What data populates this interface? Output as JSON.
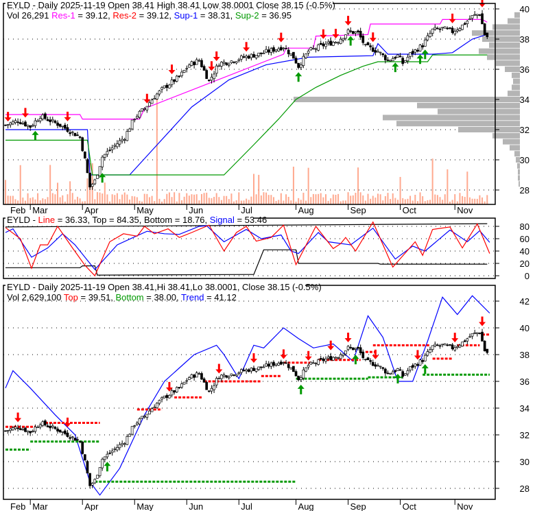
{
  "symbol": "EYLD",
  "colors": {
    "res1": "#ff00ff",
    "res2": "#ff0000",
    "sup1": "#0000ff",
    "sup2": "#009900",
    "volume": "#ffa98f",
    "profile": "#b4b4b4",
    "up_arrow": "#009900",
    "down_arrow": "#ff0000",
    "line": "#ff0000",
    "signal": "#0000ff",
    "top": "#ff0000",
    "bottom": "#009900",
    "trend": "#0000ff"
  },
  "panel1": {
    "header1": "EYLD - Daily 2025-11-19 Open 38.41  High 38.41  Low 38.0001  Close 38.15 (-0.5%)",
    "vol": "Vol 26,291",
    "res1": "Res-1",
    "res1_val": " = 39.12, ",
    "res2": "Res-2",
    "res2_val": " = 39.12, ",
    "sup1": "Sup-1",
    "sup1_val": " = 38.31, ",
    "sup2": "Sup-2",
    "sup2_val": " = 36.95",
    "y_ticks": [
      "40",
      "38",
      "36",
      "34",
      "32",
      "30",
      "28"
    ]
  },
  "panel2": {
    "prefix": "EYLD - ",
    "line": "Line",
    "line_val": " = 36.33, Top = 84.35, Bottom = 18.76, ",
    "signal": "Signal",
    "signal_val": " = 53.46",
    "y_ticks": [
      "80",
      "60",
      "40",
      "20",
      "0"
    ]
  },
  "panel3": {
    "header1": "EYLD - Daily 2025-11-19 Open 38.41,Hi 38.41,Lo 38.0001, Close 38.15 (-0.5%)",
    "vol": "Vol 2,629,100 ",
    "top": "Top",
    "top_val": " = 39.51, ",
    "bottom": "Bottom",
    "bottom_val": " = 38.00, ",
    "trend": "Trend",
    "trend_val": " = 41.12",
    "y_ticks": [
      "42",
      "40",
      "38",
      "36",
      "34",
      "32",
      "30",
      "28"
    ]
  },
  "months": [
    "Feb",
    "Mar",
    "Apr",
    "May",
    "Jun",
    "Jul",
    "Aug",
    "Sep",
    "Oct",
    "Nov"
  ],
  "chart_data": [
    {
      "type": "line",
      "title": "EYLD - Daily price with support/resistance",
      "x_unit": "trading day index (Feb 20 = 0, Nov 19 = 194)",
      "month_ticks": {
        "Mar": 10,
        "Apr": 31,
        "May": 52,
        "Jun": 73,
        "Jul": 94,
        "Aug": 117,
        "Sep": 138,
        "Oct": 159,
        "Nov": 181
      },
      "ylim": [
        27.5,
        40.3
      ],
      "close": [
        [
          0,
          32.3
        ],
        [
          5,
          32.6
        ],
        [
          10,
          32.2
        ],
        [
          14,
          32.9
        ],
        [
          18,
          32.6
        ],
        [
          22,
          32.3
        ],
        [
          26,
          31.9
        ],
        [
          30,
          31.5
        ],
        [
          32,
          30
        ],
        [
          34,
          28.2
        ],
        [
          36,
          28.6
        ],
        [
          39,
          30.2
        ],
        [
          43,
          30.8
        ],
        [
          48,
          31.5
        ],
        [
          52,
          32.8
        ],
        [
          56,
          33.4
        ],
        [
          60,
          34.2
        ],
        [
          64,
          34.8
        ],
        [
          70,
          35.5
        ],
        [
          74,
          36.3
        ],
        [
          78,
          36.6
        ],
        [
          82,
          35.2
        ],
        [
          86,
          36.4
        ],
        [
          90,
          36.5
        ],
        [
          96,
          36.8
        ],
        [
          102,
          37.0
        ],
        [
          108,
          37.3
        ],
        [
          112,
          37.5
        ],
        [
          116,
          36.8
        ],
        [
          118,
          36.2
        ],
        [
          122,
          37.2
        ],
        [
          128,
          37.6
        ],
        [
          134,
          37.9
        ],
        [
          138,
          38.5
        ],
        [
          142,
          38.4
        ],
        [
          145,
          37.5
        ],
        [
          150,
          37.2
        ],
        [
          154,
          36.6
        ],
        [
          158,
          36.9
        ],
        [
          160,
          36.4
        ],
        [
          163,
          37.0
        ],
        [
          168,
          37.6
        ],
        [
          172,
          38.6
        ],
        [
          176,
          38.7
        ],
        [
          180,
          38.5
        ],
        [
          184,
          38.9
        ],
        [
          188,
          39.5
        ],
        [
          191,
          39.7
        ],
        [
          193,
          38.3
        ],
        [
          194,
          38.15
        ]
      ],
      "res1": [
        [
          0,
          33.0
        ],
        [
          30,
          33.0
        ],
        [
          31,
          32.7
        ],
        [
          54,
          32.7
        ],
        [
          56,
          33.4
        ],
        [
          112,
          37.0
        ],
        [
          113,
          37.4
        ],
        [
          124,
          37.4
        ],
        [
          125,
          38.2
        ],
        [
          146,
          38.3
        ],
        [
          147,
          39.0
        ],
        [
          175,
          39.0
        ],
        [
          176,
          39.3
        ],
        [
          192,
          39.3
        ],
        [
          194,
          39.12
        ]
      ],
      "sup1": [
        [
          0,
          32.0
        ],
        [
          33,
          32.0
        ],
        [
          34,
          29.0
        ],
        [
          50,
          29.0
        ],
        [
          60,
          30.8
        ],
        [
          75,
          33.5
        ],
        [
          90,
          35.3
        ],
        [
          105,
          36.3
        ],
        [
          122,
          36.8
        ],
        [
          148,
          36.9
        ],
        [
          150,
          37.7
        ],
        [
          154,
          37.0
        ],
        [
          172,
          37.0
        ],
        [
          180,
          37.1
        ],
        [
          188,
          38.0
        ],
        [
          194,
          38.31
        ]
      ],
      "sup2": [
        [
          0,
          31.3
        ],
        [
          33,
          31.3
        ],
        [
          35,
          29.0
        ],
        [
          88,
          29.0
        ],
        [
          100,
          31.0
        ],
        [
          110,
          32.7
        ],
        [
          117,
          34.0
        ],
        [
          125,
          34.8
        ],
        [
          135,
          35.6
        ],
        [
          144,
          36.2
        ],
        [
          150,
          36.5
        ],
        [
          170,
          36.5
        ],
        [
          172,
          36.95
        ],
        [
          194,
          36.95
        ]
      ],
      "down_arrows": [
        1,
        8,
        25,
        57,
        67,
        83,
        85,
        97,
        111,
        128,
        133,
        138,
        148,
        180,
        192
      ],
      "up_arrows": [
        12,
        39,
        118,
        139,
        157,
        167,
        169
      ],
      "volume_profile": [
        [
          40,
          0
        ],
        [
          39.6,
          8
        ],
        [
          39.2,
          18
        ],
        [
          38.8,
          40
        ],
        [
          38.4,
          70
        ],
        [
          38.0,
          55
        ],
        [
          37.6,
          45
        ],
        [
          37.2,
          60
        ],
        [
          36.8,
          48
        ],
        [
          36.4,
          35
        ],
        [
          36.0,
          22
        ],
        [
          35.6,
          12
        ],
        [
          35.2,
          10
        ],
        [
          34.8,
          12
        ],
        [
          34.4,
          18
        ],
        [
          34.0,
          330
        ],
        [
          33.6,
          150
        ],
        [
          33.2,
          120
        ],
        [
          32.8,
          200
        ],
        [
          32.4,
          180
        ],
        [
          32.0,
          90
        ],
        [
          31.6,
          40
        ],
        [
          31.2,
          25
        ],
        [
          30.8,
          15
        ],
        [
          30.4,
          8
        ],
        [
          30.0,
          6
        ],
        [
          29.6,
          4
        ],
        [
          29.2,
          3
        ],
        [
          28.8,
          3
        ],
        [
          28.4,
          2
        ]
      ]
    },
    {
      "type": "line",
      "title": "EYLD - Line / Signal oscillator",
      "ylim": [
        0,
        85
      ],
      "line": [
        [
          0,
          78
        ],
        [
          6,
          60
        ],
        [
          10.5,
          12
        ],
        [
          14,
          50
        ],
        [
          17,
          50
        ],
        [
          21,
          80
        ],
        [
          27,
          45
        ],
        [
          32,
          17
        ],
        [
          36,
          0
        ],
        [
          42,
          55
        ],
        [
          47.5,
          68
        ],
        [
          53,
          64
        ],
        [
          56,
          80
        ],
        [
          60,
          68
        ],
        [
          65.5,
          76
        ],
        [
          70,
          62
        ],
        [
          75,
          70
        ],
        [
          82,
          82
        ],
        [
          88,
          40
        ],
        [
          93,
          70
        ],
        [
          97,
          80
        ],
        [
          101,
          56
        ],
        [
          107,
          62
        ],
        [
          112,
          82
        ],
        [
          117,
          18
        ],
        [
          125,
          80
        ],
        [
          132,
          44
        ],
        [
          135,
          52
        ],
        [
          137,
          62
        ],
        [
          141,
          40
        ],
        [
          148,
          87
        ],
        [
          156,
          14
        ],
        [
          165,
          55
        ],
        [
          168,
          33
        ],
        [
          172,
          75
        ],
        [
          179,
          79
        ],
        [
          184,
          45
        ],
        [
          190,
          84
        ],
        [
          195,
          36
        ]
      ],
      "signal": [
        [
          0,
          70
        ],
        [
          3,
          76
        ],
        [
          10.5,
          30
        ],
        [
          17,
          45
        ],
        [
          23,
          68
        ],
        [
          28,
          50
        ],
        [
          36,
          10
        ],
        [
          45,
          50
        ],
        [
          52,
          63
        ],
        [
          57,
          72
        ],
        [
          64,
          68
        ],
        [
          70,
          67
        ],
        [
          78,
          80
        ],
        [
          81,
          81
        ],
        [
          88,
          55
        ],
        [
          97,
          75
        ],
        [
          103,
          60
        ],
        [
          111,
          66
        ],
        [
          115,
          40
        ],
        [
          118,
          36
        ],
        [
          126,
          70
        ],
        [
          130,
          55
        ],
        [
          139,
          50
        ],
        [
          148,
          77
        ],
        [
          157,
          27
        ],
        [
          164,
          48
        ],
        [
          169,
          40
        ],
        [
          179,
          74
        ],
        [
          186,
          55
        ],
        [
          191,
          73
        ],
        [
          195,
          54
        ]
      ],
      "top": [
        [
          0,
          79
        ],
        [
          194,
          84.35
        ]
      ],
      "bottom": [
        [
          0,
          13
        ],
        [
          30,
          13
        ],
        [
          31,
          16
        ],
        [
          36,
          16
        ],
        [
          37,
          1
        ],
        [
          98,
          2
        ],
        [
          100,
          2
        ],
        [
          104,
          42
        ],
        [
          117,
          42
        ],
        [
          118,
          20
        ],
        [
          150,
          20
        ],
        [
          151,
          18.76
        ],
        [
          194,
          18.76
        ]
      ]
    },
    {
      "type": "line",
      "title": "EYLD - Daily with Top/Bottom/Trend",
      "ylim": [
        27,
        43
      ],
      "trend": [
        [
          0,
          35.5
        ],
        [
          3,
          36.8
        ],
        [
          10,
          35.5
        ],
        [
          20,
          33.5
        ],
        [
          28,
          32
        ],
        [
          34,
          28.5
        ],
        [
          38,
          27.5
        ],
        [
          46,
          29.5
        ],
        [
          56,
          33.5
        ],
        [
          64,
          36
        ],
        [
          70,
          37
        ],
        [
          76,
          38
        ],
        [
          85,
          38.7
        ],
        [
          88,
          38
        ],
        [
          94,
          36.2
        ],
        [
          100,
          38.7
        ],
        [
          104,
          38.5
        ],
        [
          112,
          40
        ],
        [
          118,
          39.2
        ],
        [
          124,
          38.5
        ],
        [
          132,
          38.8
        ],
        [
          140,
          37.5
        ],
        [
          146,
          40.9
        ],
        [
          152,
          39.3
        ],
        [
          158,
          36
        ],
        [
          164,
          36
        ],
        [
          170,
          39
        ],
        [
          176,
          42.3
        ],
        [
          182,
          41
        ],
        [
          188,
          42.4
        ],
        [
          195,
          41.1
        ]
      ],
      "top_segments": [
        [
          0,
          12,
          32.6
        ],
        [
          16,
          38,
          32.9
        ],
        [
          53,
          63,
          33.9
        ],
        [
          68,
          79,
          34.8
        ],
        [
          80,
          103,
          36.0
        ],
        [
          103,
          111,
          36.4
        ],
        [
          112,
          123,
          37.4
        ],
        [
          126,
          143,
          37.6
        ],
        [
          145,
          150,
          38.2
        ],
        [
          148,
          171,
          38.7
        ],
        [
          172,
          180,
          37.7
        ],
        [
          182,
          191,
          38.7
        ],
        [
          192,
          195,
          39.5
        ]
      ],
      "bottom_segments": [
        [
          0,
          10,
          30.9
        ],
        [
          10,
          38,
          31.5
        ],
        [
          36,
          117,
          28.5
        ],
        [
          117,
          146,
          36.2
        ],
        [
          146,
          160,
          36.3
        ],
        [
          168,
          195,
          36.5
        ]
      ],
      "down_arrows": [
        5,
        25,
        66,
        86,
        100,
        112,
        122,
        131,
        138,
        149,
        166,
        181,
        192
      ],
      "up_arrows": [
        41,
        119,
        141,
        158,
        169
      ]
    }
  ]
}
